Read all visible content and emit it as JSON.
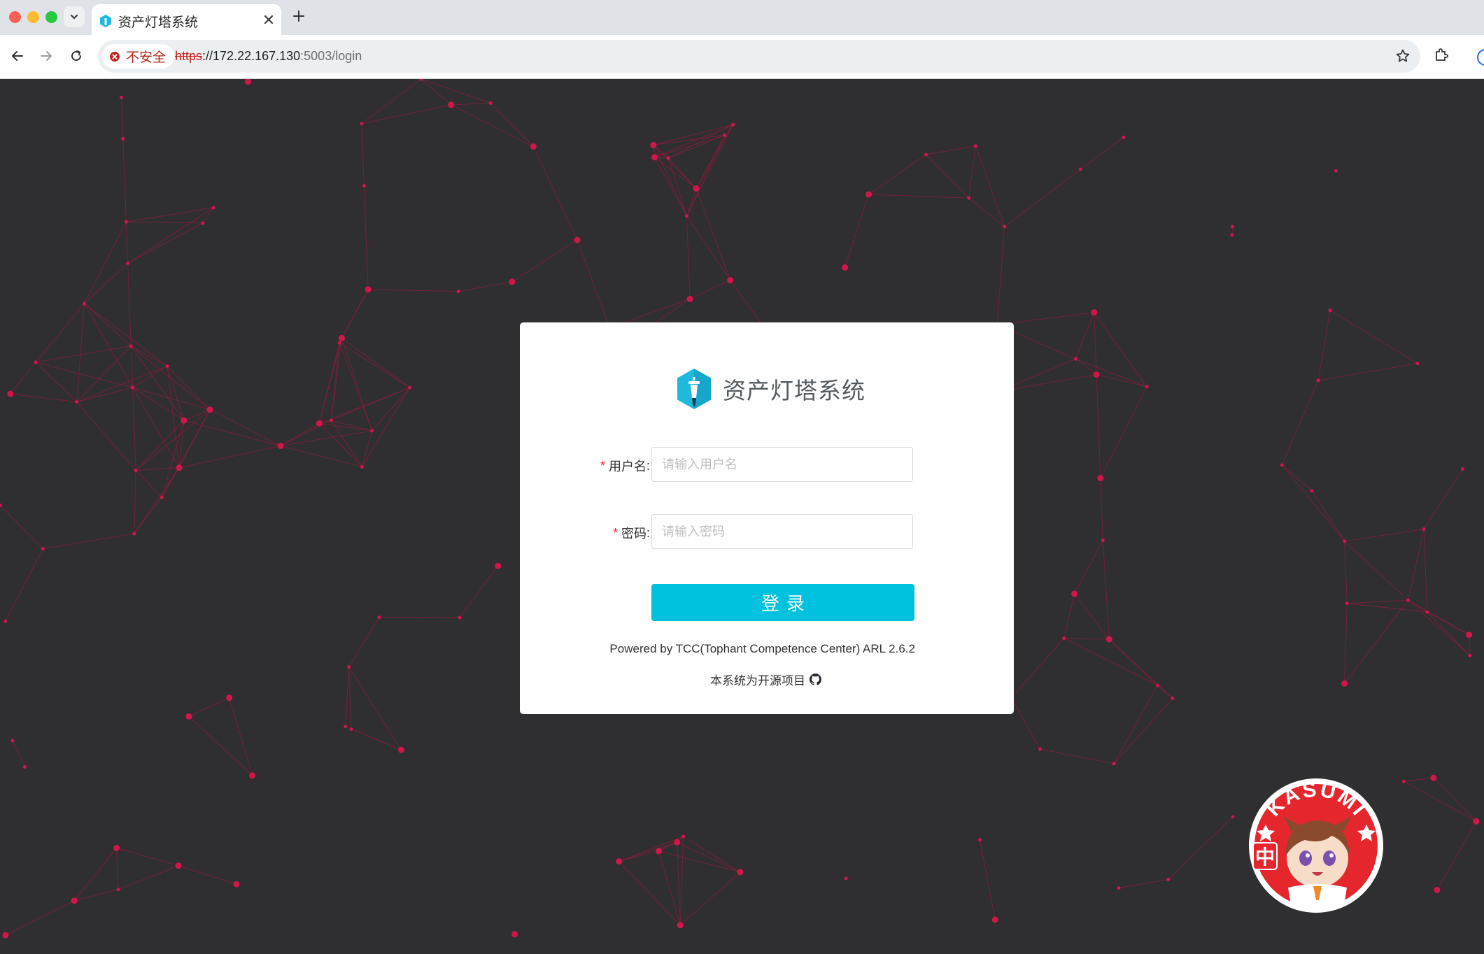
{
  "browser": {
    "tab": {
      "title": "资产灯塔系统"
    },
    "security_label": "不安全",
    "url": {
      "scheme": "https",
      "host": "://172.22.167.130",
      "rest": ":5003/login"
    }
  },
  "login": {
    "brand_title": "资产灯塔系统",
    "username": {
      "label": "用户名",
      "required_mark": "*",
      "colon": ":",
      "placeholder": "请输入用户名",
      "value": ""
    },
    "password": {
      "label": "密码",
      "required_mark": "*",
      "colon": ":",
      "placeholder": "请输入密码",
      "value": ""
    },
    "submit_label": "登录",
    "powered_by": "Powered by TCC(Tophant Competence Center) ARL 2.6.2",
    "open_source_note": "本系统为开源项目"
  },
  "mascot": {
    "badge_text": "KASUMI",
    "side_glyph": "中"
  },
  "colors": {
    "background": "#2f2e30",
    "network_node": "#d0174c",
    "network_line": "#8a1d3c",
    "primary_button": "#00c1de",
    "brand_icon": "#1fb9de"
  }
}
